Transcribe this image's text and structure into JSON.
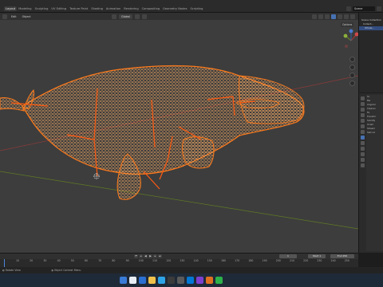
{
  "workspaces": [
    "Layout",
    "Modeling",
    "Sculpting",
    "UV Editing",
    "Texture Paint",
    "Shading",
    "Animation",
    "Rendering",
    "Compositing",
    "Geometry Nodes",
    "Scripting"
  ],
  "active_workspace": "Layout",
  "scene_name": "Scene",
  "viewport_header": {
    "mode_menu": "Edit",
    "object_menu": "Object",
    "orientation": "Global"
  },
  "viewport": {
    "options_label": "Options",
    "gizmo_axes": [
      "X",
      "Y",
      "Z"
    ]
  },
  "outliner": {
    "rows": [
      "Scene Collection",
      "Collect...",
      "Whale..."
    ]
  },
  "properties": {
    "lines": [
      "",
      "Sc",
      "Ma",
      "Angular",
      "",
      "Clearan",
      "",
      "Fa",
      "Transfor",
      "",
      "Solidify",
      "",
      "",
      "Unam",
      "",
      "",
      "Stream",
      "Self-col"
    ]
  },
  "timeline": {
    "ticks": [
      "10",
      "20",
      "30",
      "40",
      "50",
      "60",
      "70",
      "80",
      "90",
      "100",
      "110",
      "120",
      "130",
      "140",
      "150",
      "160",
      "170",
      "180",
      "190",
      "200",
      "210",
      "220",
      "230",
      "240",
      "250"
    ],
    "current_frame": "1",
    "start_label": "Start",
    "start_value": "1",
    "end_label": "End",
    "end_value": "250"
  },
  "statusbar": {
    "rotate_view": "Rotate View",
    "context_menu": "Object Context Menu"
  },
  "taskbar": {
    "icon_colors": [
      "#3a7bd5",
      "#e8eef5",
      "#2b6fd1",
      "#f0c14b",
      "#2ea3e6",
      "#3b3b3b",
      "#5a5a5a",
      "#0078d4",
      "#7d3fd0",
      "#e07020",
      "#2db14a"
    ],
    "clock": ""
  },
  "colors": {
    "wireframe": "#ff7a1a",
    "selection": "#ff8a33",
    "x_axis": "#a83434",
    "y_axis": "#6e8a2a"
  }
}
